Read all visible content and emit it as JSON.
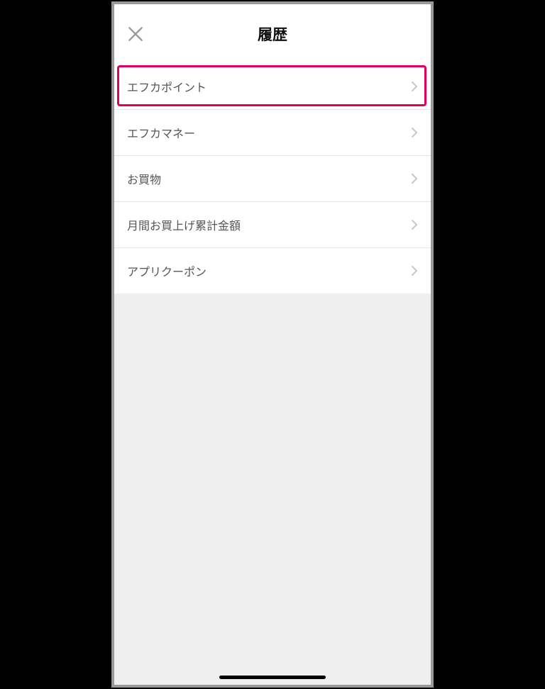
{
  "header": {
    "title": "履歴"
  },
  "list": {
    "items": [
      {
        "label": "エフカポイント",
        "highlighted": true
      },
      {
        "label": "エフカマネー",
        "highlighted": false
      },
      {
        "label": "お買物",
        "highlighted": false
      },
      {
        "label": "月間お買上げ累計金額",
        "highlighted": false
      },
      {
        "label": "アプリクーポン",
        "highlighted": false
      }
    ]
  },
  "highlight_color": "#e3005d"
}
